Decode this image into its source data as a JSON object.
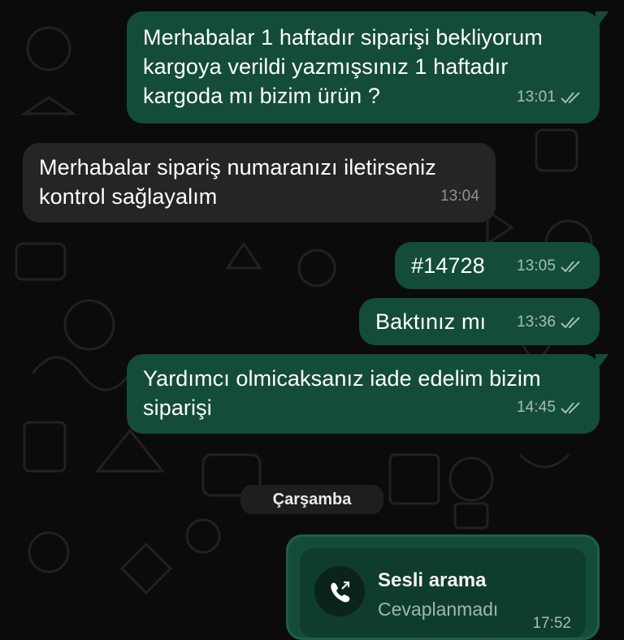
{
  "messages": [
    {
      "direction": "outgoing",
      "lines": [
        "Merhabalar 1 haftadır siparişi bekliyorum",
        "kargoya verildi yazmışsınız 1 haftadır",
        "kargoda mı bizim ürün ?"
      ],
      "time": "13:01",
      "status": "read"
    },
    {
      "direction": "incoming",
      "lines": [
        "Merhabalar sipariş numaranızı iletirseniz",
        "kontrol sağlayalım"
      ],
      "time": "13:04"
    },
    {
      "direction": "outgoing",
      "lines": [
        "#14728"
      ],
      "time": "13:05",
      "status": "read"
    },
    {
      "direction": "outgoing",
      "lines": [
        "Baktınız mı"
      ],
      "time": "13:36",
      "status": "read"
    },
    {
      "direction": "outgoing",
      "lines": [
        "Yardımcı olmicaksanız iade edelim bizim",
        "siparişi"
      ],
      "time": "14:45",
      "status": "read"
    }
  ],
  "date_separator": "Çarşamba",
  "call": {
    "title": "Sesli arama",
    "subtitle": "Cevaplanmadı",
    "time": "17:52",
    "icon": "outgoing-call-icon"
  },
  "colors": {
    "outgoing_bubble": "#144d37",
    "incoming_bubble": "#242626",
    "background": "#0b0b0b",
    "meta_text": "#a6bdb1"
  },
  "icons": {
    "read_receipt": "double-check-icon"
  }
}
